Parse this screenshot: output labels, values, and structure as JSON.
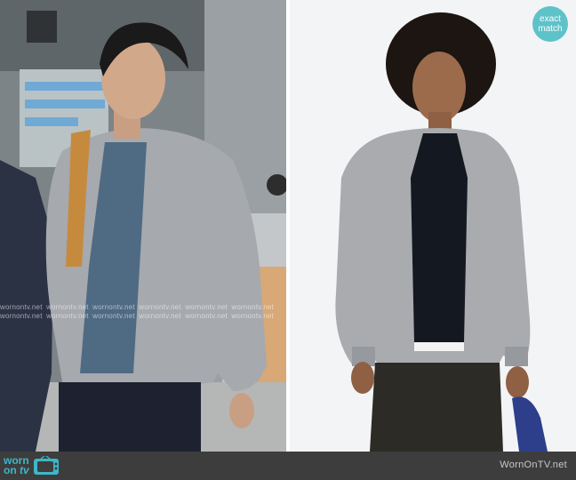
{
  "badge": {
    "line1": "exact",
    "line2": "match"
  },
  "watermark": {
    "text": "wornontv.net"
  },
  "footer": {
    "logo_line1": "worn",
    "logo_line2": "on",
    "logo_line3": "tv",
    "site_url": "WornOnTV.net"
  },
  "colors": {
    "accent": "#5ec2c9",
    "footer_bg": "#3d3d3d",
    "jacket_grey": "#a6a9ae"
  }
}
